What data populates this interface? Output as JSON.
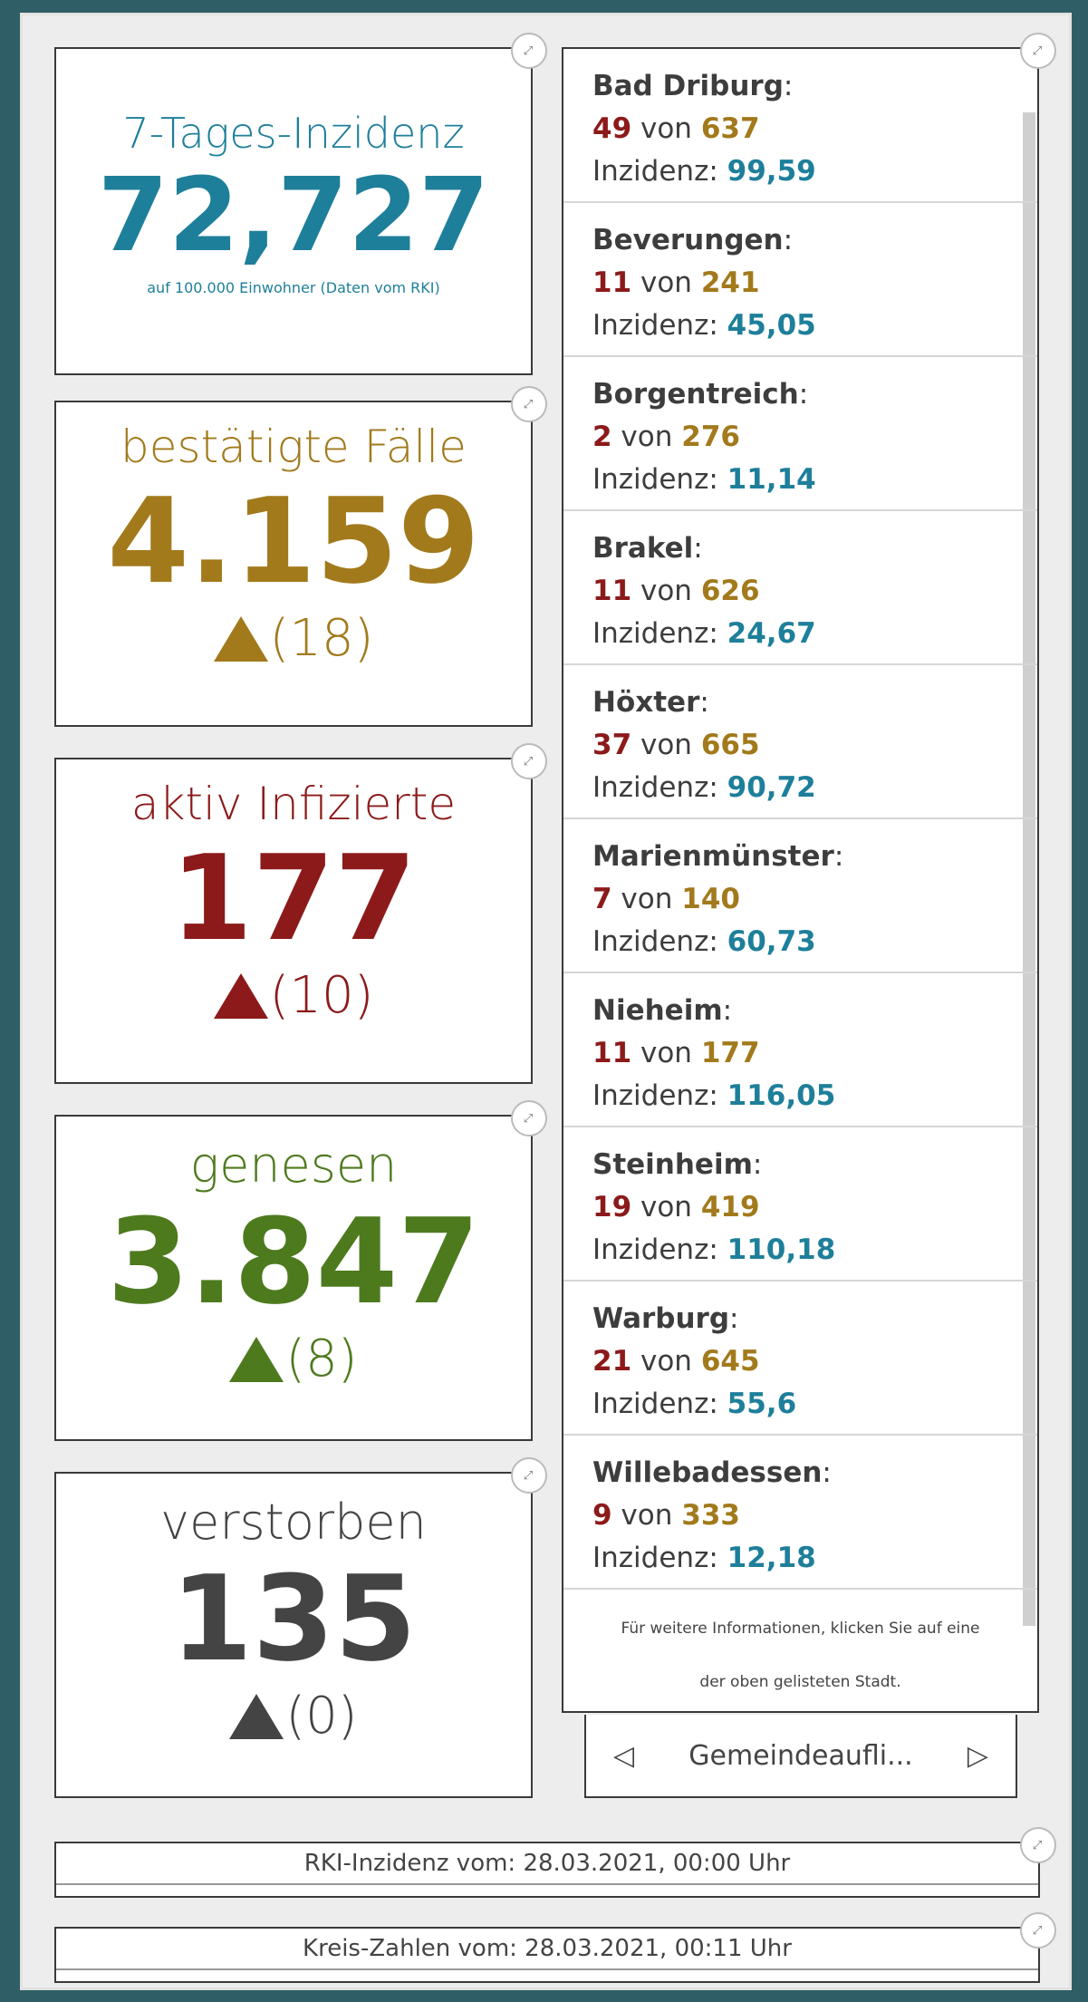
{
  "cards": {
    "inzidenz": {
      "title": "7-Tages-Inzidenz",
      "value": "72,727",
      "subtitle": "auf 100.000 Einwohner (Daten vom RKI)",
      "color": "#1e7f9a"
    },
    "faelle": {
      "title": "bestätigte Fälle",
      "value": "4.159",
      "delta": "(18)",
      "color": "#a27a1c"
    },
    "aktiv": {
      "title": "aktiv Infizierte",
      "value": "177",
      "delta": "(10)",
      "color": "#8c1a1a"
    },
    "genesen": {
      "title": "genesen",
      "value": "3.847",
      "delta": "(8)",
      "color": "#4e7a1e"
    },
    "verstorben": {
      "title": "verstorben",
      "value": "135",
      "delta": "(0)",
      "color": "#444444"
    }
  },
  "cities": [
    {
      "name": "Bad Driburg",
      "a": "49",
      "b": "637",
      "inz": "99,59"
    },
    {
      "name": "Beverungen",
      "a": "11",
      "b": "241",
      "inz": "45,05"
    },
    {
      "name": "Borgentreich",
      "a": "2",
      "b": "276",
      "inz": "11,14"
    },
    {
      "name": "Brakel",
      "a": "11",
      "b": "626",
      "inz": "24,67"
    },
    {
      "name": "Höxter",
      "a": "37",
      "b": "665",
      "inz": "90,72"
    },
    {
      "name": "Marienmünster",
      "a": "7",
      "b": "140",
      "inz": "60,73"
    },
    {
      "name": "Nieheim",
      "a": "11",
      "b": "177",
      "inz": "116,05"
    },
    {
      "name": "Steinheim",
      "a": "19",
      "b": "419",
      "inz": "110,18"
    },
    {
      "name": "Warburg",
      "a": "21",
      "b": "645",
      "inz": "55,6"
    },
    {
      "name": "Willebadessen",
      "a": "9",
      "b": "333",
      "inz": "12,18"
    }
  ],
  "labels": {
    "colon": ":",
    "von": " von ",
    "inzidenz": "Inzidenz: "
  },
  "info": {
    "line1": "Für weitere Informationen, klicken Sie auf eine",
    "line2": "der oben gelisteten Stadt."
  },
  "pager": {
    "label": "Gemeindeaufli...",
    "prev": "◁",
    "next": "▷"
  },
  "footer": {
    "rki": "RKI-Inzidenz vom: 28.03.2021, 00:00 Uhr",
    "kreis": "Kreis-Zahlen vom: 28.03.2021, 00:11 Uhr"
  },
  "icons": {
    "expand": "expand-icon"
  }
}
